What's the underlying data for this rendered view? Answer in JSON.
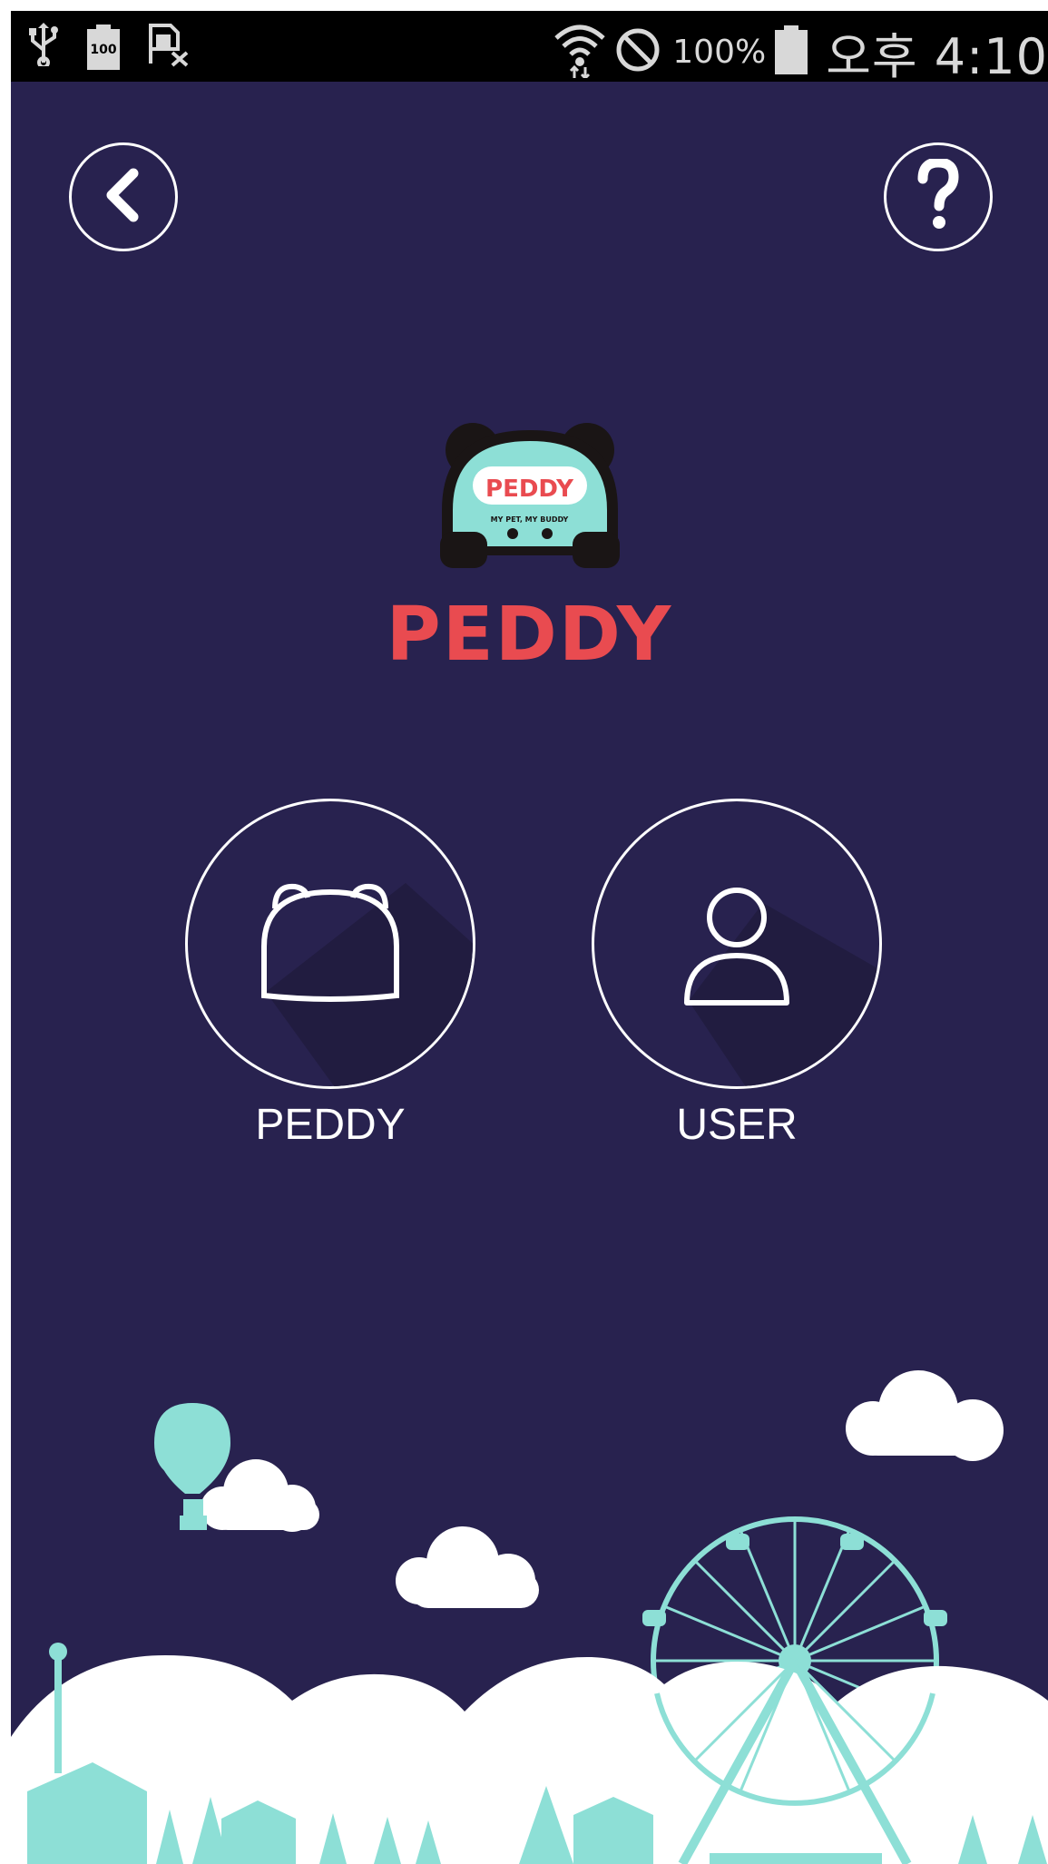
{
  "status_bar": {
    "battery_percent": "100%",
    "time": "오후 4:10",
    "battery_widget_label": "100"
  },
  "header": {
    "back_icon": "chevron-left-icon",
    "help_icon": "question-mark-icon"
  },
  "logo": {
    "badge_text": "PEDDY",
    "tagline": "MY PET, MY BUDDY",
    "brand_name": "PEDDY"
  },
  "choices": [
    {
      "label": "PEDDY",
      "icon": "robot-head-icon"
    },
    {
      "label": "USER",
      "icon": "person-icon"
    }
  ],
  "colors": {
    "background": "#28224f",
    "accent_red": "#e94b50",
    "mint": "#8ddfd6",
    "white": "#ffffff"
  }
}
